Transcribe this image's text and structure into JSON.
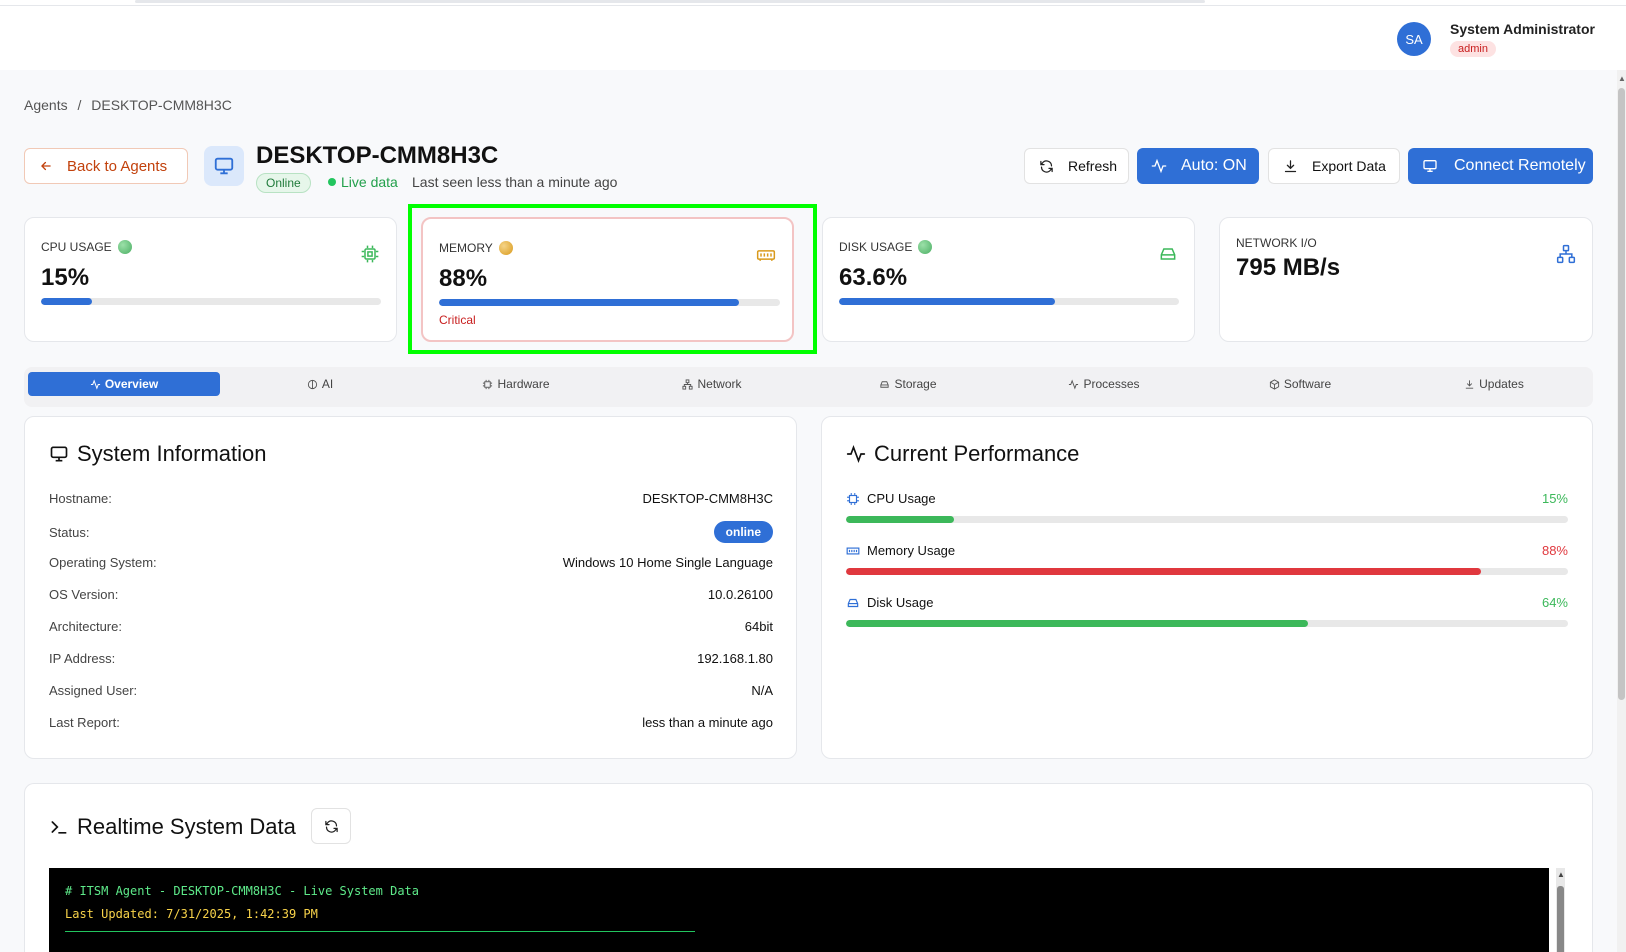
{
  "user": {
    "initials": "SA",
    "name": "System Administrator",
    "role": "admin"
  },
  "breadcrumb": {
    "root": "Agents",
    "separator": "/",
    "current": "DESKTOP-CMM8H3C"
  },
  "agent": {
    "back_label": "Back to Agents",
    "hostname": "DESKTOP-CMM8H3C",
    "status_badge": "Online",
    "live_label": "Live data",
    "last_seen": "Last seen less than a minute ago"
  },
  "actions": {
    "refresh": "Refresh",
    "auto": "Auto: ON",
    "export": "Export Data",
    "connect": "Connect Remotely"
  },
  "stats": {
    "cpu": {
      "label": "CPU USAGE",
      "value": "15%",
      "percent": 15,
      "indicator_color": "#4caf64"
    },
    "memory": {
      "label": "MEMORY",
      "value": "88%",
      "percent": 88,
      "indicator_color": "#e0a82e",
      "status": "Critical"
    },
    "disk": {
      "label": "DISK USAGE",
      "value": "63.6%",
      "percent": 63.6,
      "indicator_color": "#4caf64"
    },
    "network": {
      "label": "NETWORK I/O",
      "value": "795 MB/s"
    }
  },
  "tabs": [
    "Overview",
    "AI",
    "Hardware",
    "Network",
    "Storage",
    "Processes",
    "Software",
    "Updates"
  ],
  "system_info": {
    "title": "System Information",
    "rows": [
      {
        "key": "Hostname:",
        "value": "DESKTOP-CMM8H3C"
      },
      {
        "key": "Status:",
        "value": "online"
      },
      {
        "key": "Operating System:",
        "value": "Windows 10 Home Single Language"
      },
      {
        "key": "OS Version:",
        "value": "10.0.26100"
      },
      {
        "key": "Architecture:",
        "value": "64bit"
      },
      {
        "key": "IP Address:",
        "value": "192.168.1.80"
      },
      {
        "key": "Assigned User:",
        "value": "N/A"
      },
      {
        "key": "Last Report:",
        "value": "less than a minute ago"
      }
    ]
  },
  "performance": {
    "title": "Current Performance",
    "items": [
      {
        "label": "CPU Usage",
        "value": "15%",
        "percent": 15,
        "color": "#3cb85a"
      },
      {
        "label": "Memory Usage",
        "value": "88%",
        "percent": 88,
        "color": "#e0383e"
      },
      {
        "label": "Disk Usage",
        "value": "64%",
        "percent": 64,
        "color": "#3cb85a"
      }
    ]
  },
  "realtime": {
    "title": "Realtime System Data",
    "line1": "# ITSM Agent - DESKTOP-CMM8H3C - Live System Data",
    "line2": "Last Updated: 7/31/2025, 1:42:39 PM"
  },
  "colors": {
    "primary": "#2f6fd6",
    "success": "#3cb85a",
    "danger": "#e0383e",
    "highlight": "#00ff00"
  }
}
